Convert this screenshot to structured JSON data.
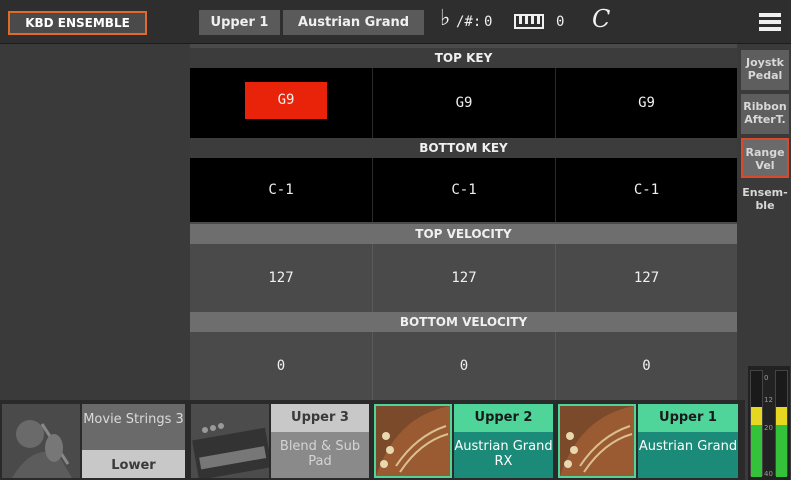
{
  "topbar": {
    "mode_button": "KBD ENSEMBLE",
    "keyboard_part": "Upper 1",
    "sound_name": "Austrian Grand",
    "transpose_label": "/#:",
    "transpose_value": "0",
    "octave_value": "0",
    "scale_symbol": "C",
    "menu_icon": "hamburger-menu-icon"
  },
  "grid": {
    "top_key": {
      "header": "TOP KEY",
      "values": [
        "G9",
        "G9",
        "G9"
      ]
    },
    "bottom_key": {
      "header": "BOTTOM KEY",
      "values": [
        "C-1",
        "C-1",
        "C-1"
      ]
    },
    "top_velocity": {
      "header": "TOP VELOCITY",
      "values": [
        "127",
        "127",
        "127"
      ]
    },
    "bottom_velocity": {
      "header": "BOTTOM VELOCITY",
      "values": [
        "0",
        "0",
        "0"
      ]
    }
  },
  "tabs": [
    {
      "line1": "Joystk",
      "line2": "Pedal"
    },
    {
      "line1": "Ribbon",
      "line2": "AfterT."
    },
    {
      "line1": "Range",
      "line2": "Vel"
    },
    {
      "line1": "Ensem-",
      "line2": "ble"
    }
  ],
  "meter": {
    "ticks": [
      "0",
      "12",
      "20",
      "40"
    ]
  },
  "bottom": {
    "lower": {
      "sound": "Movie Strings 3",
      "part": "Lower"
    },
    "upper3": {
      "part": "Upper 3",
      "sound": "Blend & Sub Pad"
    },
    "upper2": {
      "part": "Upper 2",
      "sound": "Austrian Grand RX"
    },
    "upper1": {
      "part": "Upper 1",
      "sound": "Austrian Grand"
    }
  },
  "colors": {
    "accent": "#e06a2a",
    "selected": "#e8230a",
    "active_part": "#4fd49a"
  }
}
